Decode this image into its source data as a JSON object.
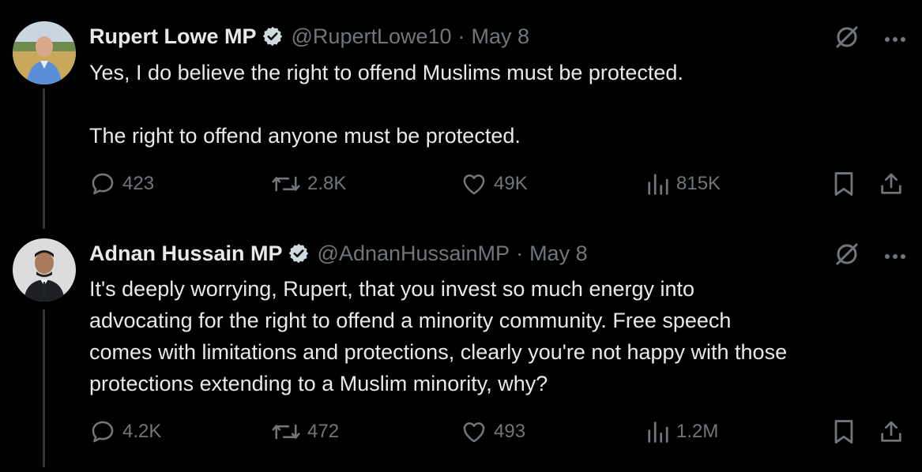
{
  "tweets": [
    {
      "name": "Rupert Lowe MP",
      "handle": "@RupertLowe10",
      "separator": "·",
      "date": "May 8",
      "paragraphs": [
        "Yes, I do believe the right to offend Muslims must be protected.",
        "The right to offend anyone must be protected."
      ],
      "stats": {
        "replies": "423",
        "reposts": "2.8K",
        "likes": "49K",
        "views": "815K"
      }
    },
    {
      "name": "Adnan Hussain MP",
      "handle": "@AdnanHussainMP",
      "separator": "·",
      "date": "May 8",
      "text_lines": [
        "It's deeply worrying, Rupert, that you invest so much energy into",
        "advocating for the right to offend a minority community. Free speech",
        "comes with limitations and protections, clearly you're not happy with those",
        "protections extending to a Muslim minority, why?"
      ],
      "stats": {
        "replies": "4.2K",
        "reposts": "472",
        "likes": "493",
        "views": "1.2M"
      }
    }
  ],
  "icons": [
    "verified-badge-icon",
    "grok-icon",
    "more-icon",
    "reply-icon",
    "repost-icon",
    "like-icon",
    "views-icon",
    "bookmark-icon",
    "share-icon"
  ],
  "colors": {
    "background": "#000000",
    "primary_text": "#e7e9ea",
    "secondary_text": "#71767b",
    "thread_line": "#333639"
  }
}
